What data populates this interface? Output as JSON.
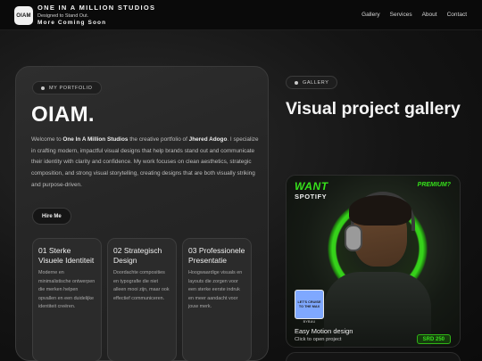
{
  "header": {
    "logo_text": "OIAM",
    "title": "ONE IN A MILLION STUDIOS",
    "tagline": "Designed to Stand Out.",
    "coming_soon": "More Coming Soon",
    "nav": [
      "Gallery",
      "Services",
      "About",
      "Contact"
    ]
  },
  "portfolio": {
    "badge": "MY PORTFOLIO",
    "heading": "OIAM.",
    "intro_prefix": "Welcome to ",
    "intro_studio": "One In A Million Studios",
    "intro_mid": " the creative portfolio of ",
    "intro_name": "Jhered Adogo",
    "intro_rest": ". I specialize in crafting modern, impactful visual designs that help brands stand out and communicate their identity with clarity and confidence. My work focuses on clean aesthetics, strategic composition, and strong visual storytelling, creating designs that are both visually striking and purpose-driven.",
    "hire_label": "Hire Me",
    "features": [
      {
        "title": "01 Sterke Visuele Identiteit",
        "desc": "Moderne en minimalistische ontwerpen die merken helpen opvallen en een duidelijke identiteit creëren."
      },
      {
        "title": "02 Strategisch Design",
        "desc": "Doordachte composities en typografie die niet alleen mooi zijn, maar ook effectief communiceren."
      },
      {
        "title": "03 Professionele Presentatie",
        "desc": "Hoogwaardige visuals en layouts die zorgen voor een sterke eerste indruk en meer aandacht voor jouw merk."
      }
    ]
  },
  "gallery": {
    "badge": "GALLERY",
    "title": "Visual project gallery",
    "item": {
      "want": "WANT",
      "spotify": "SPOTIFY",
      "premium": "PREMIUM?",
      "cover_text": "LET'S CRUISE TO THE MAX",
      "cover_caption": "BYBAU",
      "name": "Easy Motion design",
      "hint": "Click to open project",
      "price": "SRD 250"
    }
  },
  "colors": {
    "accent_green": "#36e21b",
    "background": "#0e0e0e",
    "card": "#262626"
  }
}
